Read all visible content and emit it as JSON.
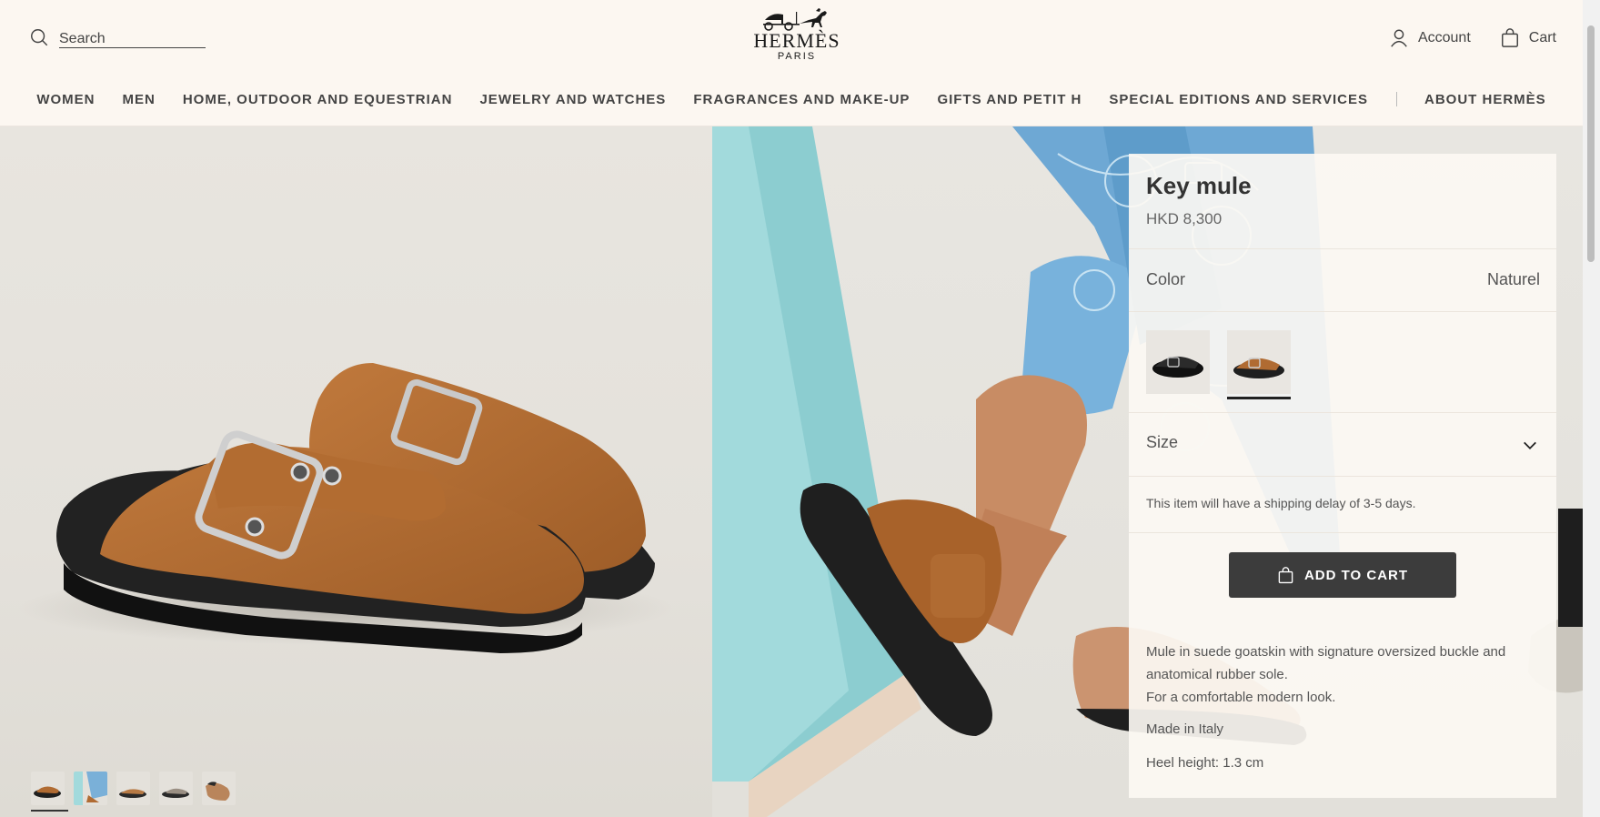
{
  "header": {
    "search_placeholder": "Search",
    "logo_word": "HERMÈS",
    "logo_sub": "PARIS",
    "account_label": "Account",
    "cart_label": "Cart"
  },
  "nav": {
    "items": [
      "WOMEN",
      "MEN",
      "HOME, OUTDOOR AND EQUESTRIAN",
      "JEWELRY AND WATCHES",
      "FRAGRANCES AND MAKE-UP",
      "GIFTS AND PETIT H",
      "SPECIAL EDITIONS AND SERVICES"
    ],
    "about": "ABOUT HERMÈS"
  },
  "product": {
    "title": "Key mule",
    "price": "HKD 8,300",
    "color_label": "Color",
    "color_value": "Naturel",
    "size_label": "Size",
    "shipping_note": "This item will have a shipping delay of 3-5 days.",
    "add_to_cart": "ADD TO CART",
    "description_1": "Mule in suede goatskin with signature oversized buckle and anatomical rubber sole.",
    "description_2": "For a comfortable modern look.",
    "made_in": "Made in Italy",
    "heel_height": "Heel height: 1.3 cm"
  },
  "colors": {
    "accent": "#3c3c3c",
    "background": "#fcf7f1",
    "suede": "#b06b32"
  }
}
